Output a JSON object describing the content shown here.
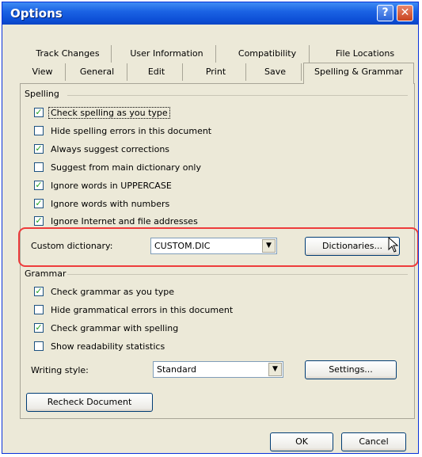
{
  "window": {
    "title": "Options",
    "help_glyph": "?",
    "close_glyph": "✕"
  },
  "tabs": {
    "row1": [
      "Track Changes",
      "User Information",
      "Compatibility",
      "File Locations"
    ],
    "row2": [
      "View",
      "General",
      "Edit",
      "Print",
      "Save",
      "Spelling & Grammar"
    ],
    "selected": "Spelling & Grammar"
  },
  "spelling": {
    "heading": "Spelling",
    "options": [
      {
        "label": "Check spelling as you type",
        "checked": true
      },
      {
        "label": "Hide spelling errors in this document",
        "checked": false
      },
      {
        "label": "Always suggest corrections",
        "checked": true
      },
      {
        "label": "Suggest from main dictionary only",
        "checked": false
      },
      {
        "label": "Ignore words in UPPERCASE",
        "checked": true
      },
      {
        "label": "Ignore words with numbers",
        "checked": true
      },
      {
        "label": "Ignore Internet and file addresses",
        "checked": true
      }
    ],
    "custom_dictionary_label": "Custom dictionary:",
    "custom_dictionary_value": "CUSTOM.DIC",
    "dictionaries_button": "Dictionaries..."
  },
  "grammar": {
    "heading": "Grammar",
    "options": [
      {
        "label": "Check grammar as you type",
        "checked": true
      },
      {
        "label": "Hide grammatical errors in this document",
        "checked": false
      },
      {
        "label": "Check grammar with spelling",
        "checked": true
      },
      {
        "label": "Show readability statistics",
        "checked": false
      }
    ],
    "writing_style_label": "Writing style:",
    "writing_style_value": "Standard",
    "settings_button": "Settings..."
  },
  "recheck_button": "Recheck Document",
  "ok_button": "OK",
  "cancel_button": "Cancel",
  "icons": {
    "checkmark": "✓",
    "dropdown_arrow": "▼",
    "cursor": "mouse-pointer-icon"
  },
  "colors": {
    "title_bar": "#1b63e4",
    "highlight": "#ee3c3c",
    "check": "#21a121"
  }
}
